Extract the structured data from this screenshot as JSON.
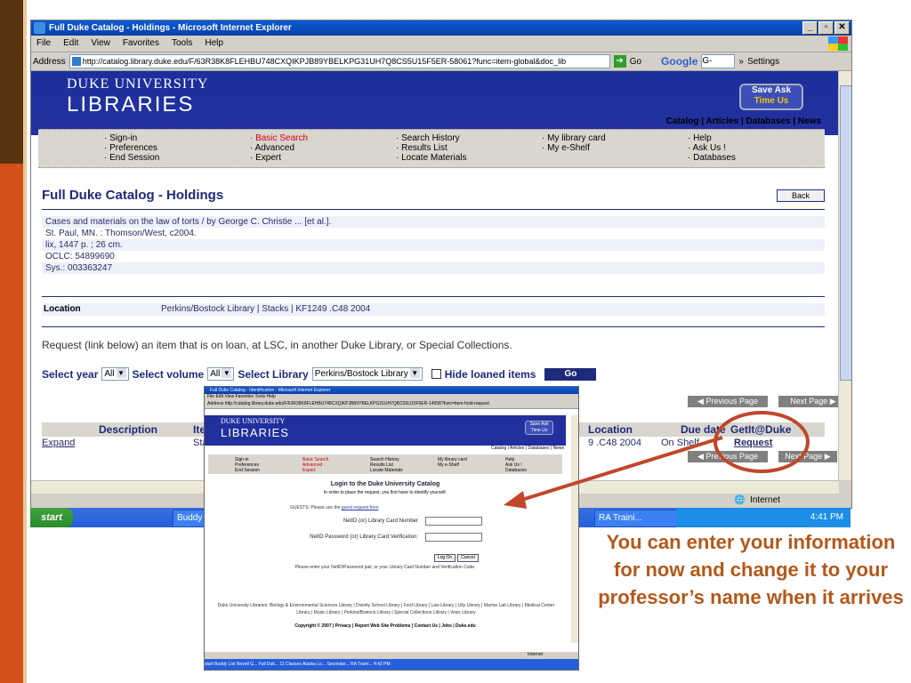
{
  "window": {
    "title": "Full Duke Catalog - Holdings - Microsoft Internet Explorer",
    "menu": [
      "File",
      "Edit",
      "View",
      "Favorites",
      "Tools",
      "Help"
    ],
    "address_label": "Address",
    "url": "http://catalog.library.duke.edu/F/63R38K8FLEHBU748CXQIKPJB89YBELKPG31UH7Q8CS5U15F5ER-58061?func=item-global&doc_lib",
    "go_label": "Go",
    "google_label": "Google",
    "google_box": "G-",
    "settings_label": "Settings",
    "status_text": "Internet"
  },
  "banner": {
    "line1": "DUKE UNIVERSITY",
    "line2": "LIBRARIES",
    "save_ask_top": "Save Ask",
    "save_ask_bottom": "Time Us"
  },
  "topnav": "Catalog | Articles | Databases | News",
  "menu_columns": [
    [
      "Sign-in",
      "Preferences",
      "End Session"
    ],
    [
      "Basic Search",
      "Advanced",
      "Expert"
    ],
    [
      "Search History",
      "Results List",
      "Locate Materials"
    ],
    [
      "My library card",
      "My e-Shelf"
    ],
    [
      "Help",
      "Ask Us !",
      "Databases"
    ]
  ],
  "page_title": "Full Duke Catalog - Holdings",
  "back_label": "Back",
  "record_lines": [
    "Cases and materials on the law of torts / by George C. Christie ... [et al.].",
    "St. Paul, MN. : Thomson/West, c2004.",
    "lix, 1447 p. ; 26 cm.",
    "OCLC:  54899690",
    "Sys.:  003363247"
  ],
  "location_label": "Location",
  "location_value": "Perkins/Bostock Library | Stacks  | KF1249 .C48 2004",
  "request_text": "Request (link below) an item that is on loan, at LSC, in another Duke Library, or Special Collections.",
  "select_year_label": "Select year",
  "select_year_value": "All",
  "select_volume_label": "Select volume",
  "select_volume_value": "All",
  "select_library_label": "Select Library",
  "select_library_value": "Perkins/Bostock Library",
  "hide_loaned_label": "Hide loaned items",
  "go_label": "Go",
  "prev_page": "Previous Page",
  "next_page": "Next Page",
  "table_headers": [
    "Description",
    "Ite",
    "Location",
    "Due date",
    "GetIt@Duke"
  ],
  "table_row": [
    "Expand",
    "Stan",
    "9 .C48 2004",
    "On Shelf",
    "Request"
  ],
  "taskbar": {
    "start": "start",
    "buddy": "Buddy",
    "ra_training": "RA Traini...",
    "clock": "4:41 PM"
  },
  "inset": {
    "title": "Full Duke Catalog - Identification - Microsoft Internet Explorer",
    "menu": "File   Edit   View   Favorites   Tools   Help",
    "address": "Address  http://catalog.library.duke.edu/F/63R38K8FLEHBU748CXQIKPJB89YBELKPG31UH7Q8CS5U15F5ER-14658?func=item-hold-request",
    "banner1": "DUKE UNIVERSITY",
    "banner2": "LIBRARIES",
    "save_ask": "Save Ask Time Us",
    "nav": "Catalog | Articles | Databases | News",
    "menu_col1": "Sign-in\nPreferences\nEnd Session",
    "menu_col2": "Basic Search\nAdvanced\nExpert",
    "menu_col3": "Search History\nResults List\nLocate Materials",
    "menu_col4": "My library card\nMy e-Shelf",
    "menu_col5": "Help\nAsk Us !\nDatabases",
    "login_title": "Login to the Duke University Catalog",
    "login_sub": "In order to place the request, you first have to identify yourself.",
    "guests_prefix": "GUESTS: Please use the ",
    "guests_link": "guest request form",
    "field1": "NetID (or) Library Card Number",
    "field2": "NetID Password (or) Library Card Verification:",
    "login_btn": "Log On",
    "cancel_btn": "Cancel",
    "please_enter": "Please enter your NetID/Password pair, or your Library Card Number and Verification Code.",
    "footer_libs": "Duke University Libraries:  Biology & Environmental Sciences Library | Divinity School Library | Ford Library | Law Library | Lilly Library | Marine Lab Library | Medical Center Library | Music Library | Perkins/Bostock Library | Special Collections Library | Vesic Library",
    "copyright": "Copyright © 2007  |  Privacy  |  Report Web Site Problems  |  Contact Us  |  Jobs  |  Duke.edu",
    "status": "Internet",
    "taskbar": "start     Buddy List   Novell G...   Full Duk...   11 Classes   Alaska Lo...   Secondar...   RA Traini...    4:42 PM"
  },
  "caption": "You can enter your information for now and change it to your professor’s name when it arrives",
  "colors": {
    "annotation": "#c0472a",
    "caption": "#b5581a",
    "banner": "#1b2f9c"
  }
}
